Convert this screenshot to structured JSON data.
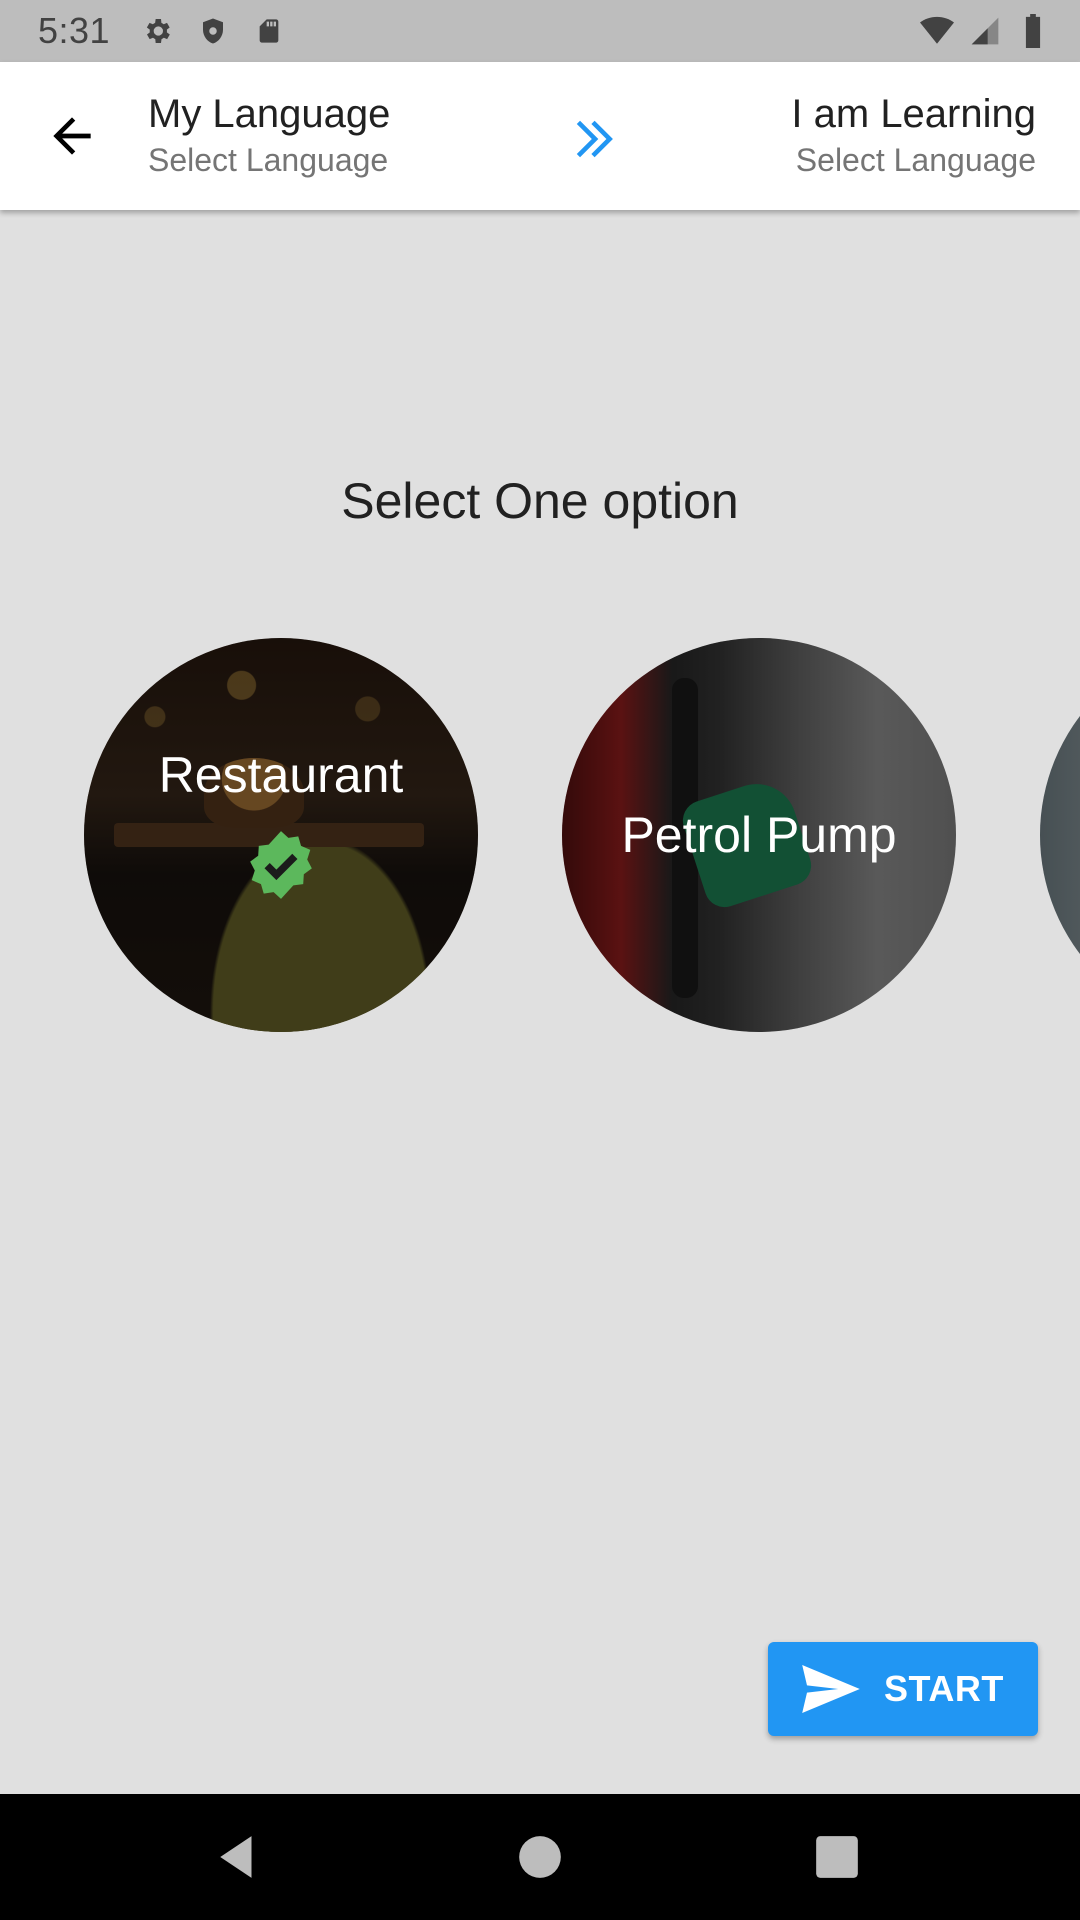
{
  "status_bar": {
    "time": "5:31",
    "left_icons": [
      "gear-icon",
      "shield-icon",
      "sd-card-icon"
    ],
    "right_icons": [
      "wifi-icon",
      "cell-signal-icon",
      "battery-icon"
    ]
  },
  "header": {
    "left": {
      "title": "My Language",
      "subtitle": "Select Language"
    },
    "right": {
      "title": "I am Learning",
      "subtitle": "Select Language"
    },
    "swap_icon": "double-chevron-right-icon",
    "back_icon": "arrow-left-icon"
  },
  "main": {
    "prompt": "Select One option",
    "options": [
      {
        "label": "Restaurant",
        "selected": true
      },
      {
        "label": "Petrol Pump",
        "selected": false
      },
      {
        "label": "",
        "selected": false
      }
    ]
  },
  "start_button": {
    "label": "START",
    "icon": "send-icon"
  },
  "nav_bar": {
    "icons": [
      "nav-back-icon",
      "nav-home-icon",
      "nav-recent-icon"
    ]
  },
  "colors": {
    "accent": "#2196f3",
    "check_badge": "#5cb85c",
    "background": "#e0e0e0",
    "status_bar": "#bdbdbd"
  }
}
